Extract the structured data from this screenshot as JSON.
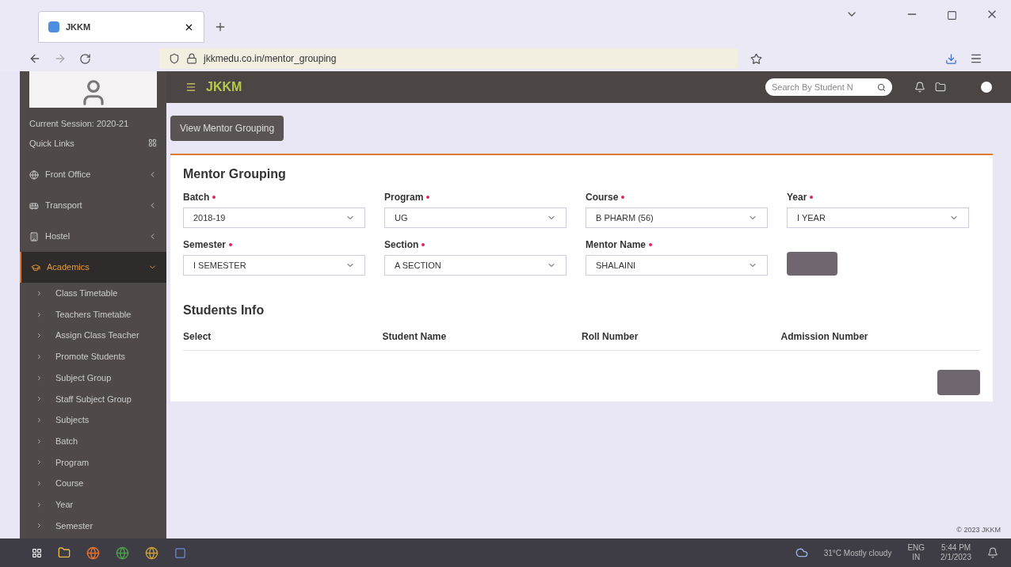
{
  "browser": {
    "tab_title": "JKKM",
    "url": "jkkmedu.co.in/mentor_grouping"
  },
  "header": {
    "brand": "JKKM",
    "search": {
      "placeholder": "Search By Student N"
    }
  },
  "sidebar": {
    "session": "Current Session: 2020-21",
    "quick_links": "Quick Links",
    "items": [
      {
        "label": "Front Office",
        "selected": false,
        "expanded": false
      },
      {
        "label": "Transport",
        "selected": false,
        "expanded": false
      },
      {
        "label": "Hostel",
        "selected": false,
        "expanded": false
      },
      {
        "label": "Academics",
        "selected": true,
        "expanded": true,
        "children": [
          "Class Timetable",
          "Teachers Timetable",
          "Assign Class Teacher",
          "Promote Students",
          "Subject Group",
          "Staff Subject Group",
          "Subjects",
          "Batch",
          "Program",
          "Course",
          "Year",
          "Semester"
        ]
      }
    ]
  },
  "view_button": "View Mentor Grouping",
  "form": {
    "title": "Mentor Grouping",
    "fields": [
      {
        "label": "Batch",
        "value": "2018-19",
        "required": true
      },
      {
        "label": "Program",
        "value": "UG",
        "required": true
      },
      {
        "label": "Course",
        "value": "B PHARM (56)",
        "required": true
      },
      {
        "label": "Year",
        "value": "I YEAR",
        "required": true
      },
      {
        "label": "Semester",
        "value": "I SEMESTER",
        "required": true
      },
      {
        "label": "Section",
        "value": "A SECTION",
        "required": true
      },
      {
        "label": "Mentor Name",
        "value": "SHALAINI",
        "required": true
      }
    ]
  },
  "students": {
    "title": "Students Info",
    "columns": [
      "Select",
      "Student Name",
      "Roll Number",
      "Admission Number"
    ]
  },
  "footer": "© 2023 JKKM",
  "taskbar": {
    "weather": "31°C  Mostly cloudy",
    "language": [
      "ENG",
      "IN"
    ],
    "time": "5:44 PM",
    "date": "2/1/2023"
  }
}
